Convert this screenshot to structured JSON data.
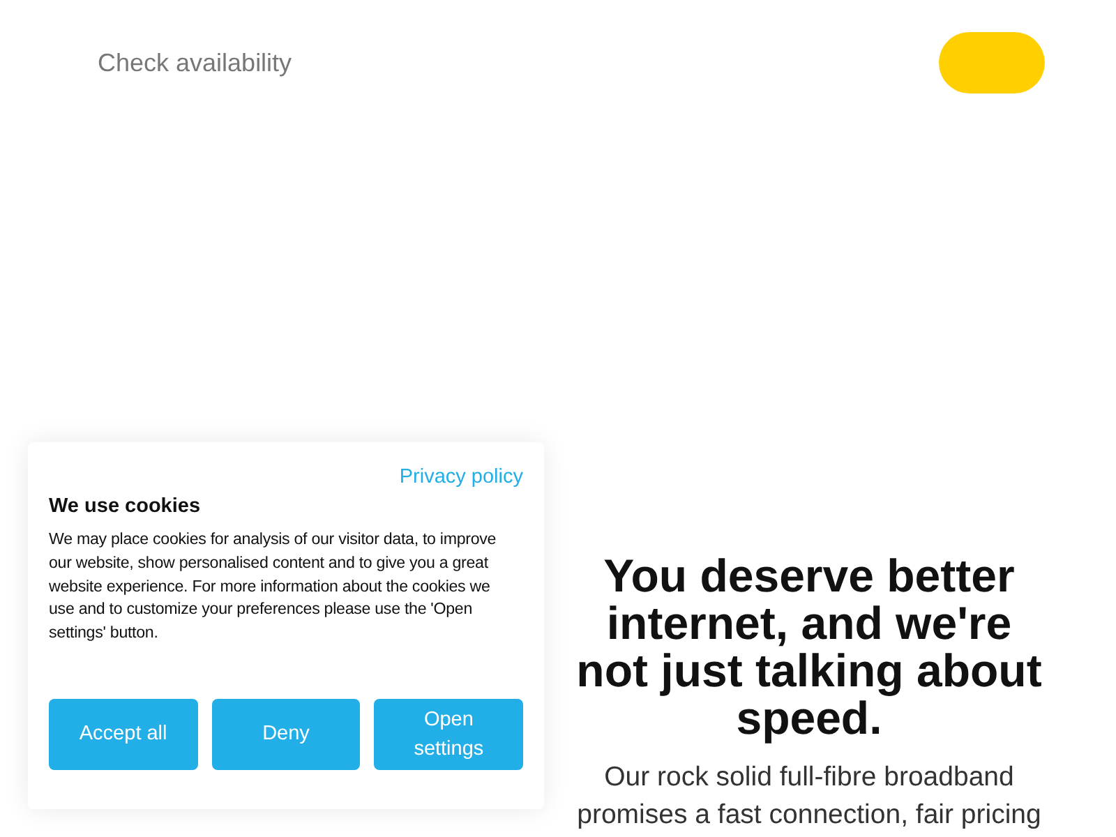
{
  "header": {
    "link": "Check availability"
  },
  "cookie_dialog": {
    "privacy_link": "Privacy policy",
    "title": "We use cookies",
    "body": "We may place cookies for analysis of our visitor data, to improve our website, show personalised content and to give you a great website experience. For more information about the cookies we use and to customize your preferences please use the 'Open settings' button.",
    "buttons": [
      "Accept all",
      "Deny",
      "Open settings"
    ]
  },
  "hero": {
    "heading": "You deserve better internet, and we're not just talking about speed.",
    "paragraph": "Our rock solid full-fibre broadband promises a fast connection, fair pricing"
  }
}
